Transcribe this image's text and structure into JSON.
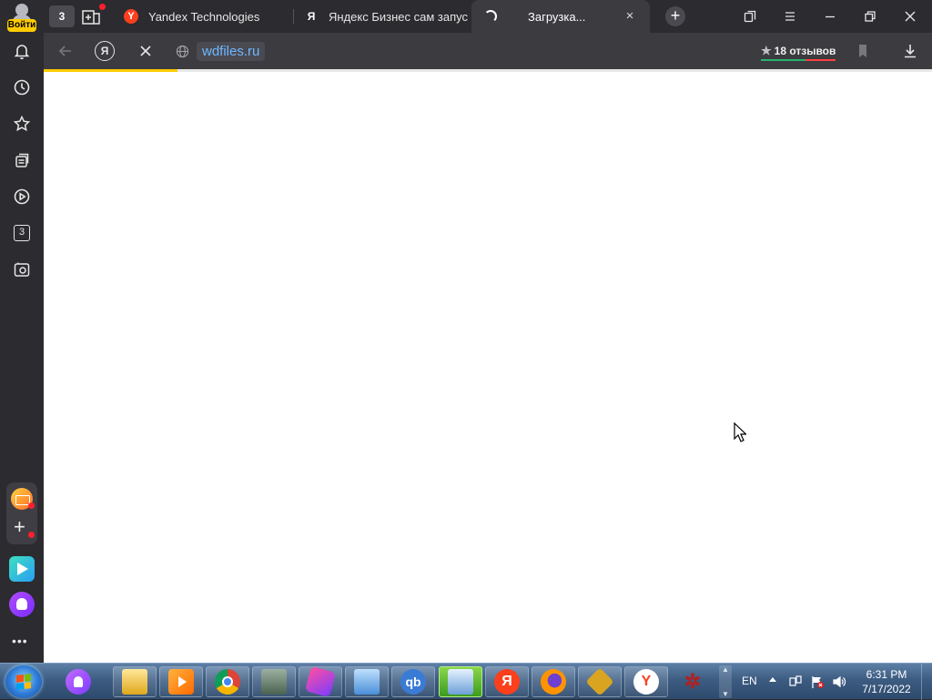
{
  "browser": {
    "tab_count": "3",
    "tabs": [
      {
        "title": "Yandex Technologies",
        "favicon": "Y"
      },
      {
        "title": "Яндекс Бизнес сам запус",
        "favicon": "Я"
      },
      {
        "title": "Загрузка...",
        "favicon": "loading-spinner"
      }
    ],
    "close_tab_glyph": "×",
    "add_tab_glyph": "+",
    "login_label": "Войти",
    "ya_button": "Я",
    "url": "wdfiles.ru",
    "reviews": "18 отзывов",
    "reviews_star": "★",
    "sidebar_badge": "3",
    "more_glyph": "•••"
  },
  "taskbar": {
    "language": "EN",
    "time": "6:31 PM",
    "date": "7/17/2022",
    "apps": [
      "alice-icon",
      "file-explorer-icon",
      "media-player-icon",
      "chrome-icon",
      "device-manager-icon",
      "gem-icon",
      "remote-desktop-icon",
      "qbittorrent-icon",
      "network-icon",
      "yandex-browser-icon",
      "firefox-icon",
      "puzzle-icon",
      "yandex-y-icon",
      "fan-icon"
    ],
    "qb_label": "qb",
    "ya_label": "Я",
    "y_label": "Y"
  },
  "colors": {
    "accent": "#ffcc00",
    "link": "#6fb8ff",
    "chrome_bg": "#2b2b30",
    "toolbar_bg": "#3b3b40",
    "yandex_red": "#fc3f1d"
  }
}
